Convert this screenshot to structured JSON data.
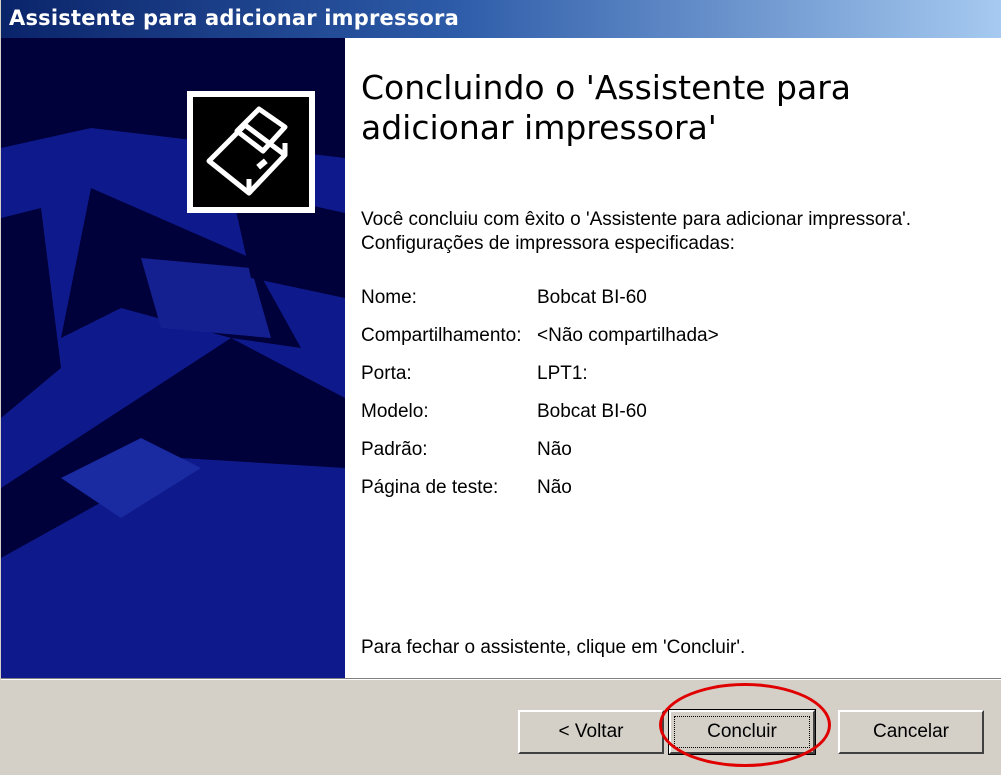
{
  "window": {
    "title": "Assistente para adicionar impressora"
  },
  "banner": {
    "icon": "printer-wizard-icon"
  },
  "main": {
    "heading": "Concluindo o 'Assistente para adicionar impressora'",
    "intro": "Você concluiu com êxito o 'Assistente para adicionar impressora'. Configurações de impressora especificadas:",
    "settings": [
      {
        "label": "Nome:",
        "value": "Bobcat BI-60"
      },
      {
        "label": "Compartilhamento:",
        "value": "<Não compartilhada>"
      },
      {
        "label": "Porta:",
        "value": "LPT1:"
      },
      {
        "label": "Modelo:",
        "value": "Bobcat BI-60"
      },
      {
        "label": "Padrão:",
        "value": "Não"
      },
      {
        "label": "Página de teste:",
        "value": "Não"
      }
    ],
    "footer": "Para fechar o assistente, clique em 'Concluir'."
  },
  "buttons": {
    "back": "< Voltar",
    "finish": "Concluir",
    "cancel": "Cancelar"
  },
  "colors": {
    "title_start": "#0a246a",
    "title_end": "#a6caf0",
    "banner_bg": "#00003a",
    "button_face": "#d4d0c8",
    "highlight": "#e00000"
  }
}
